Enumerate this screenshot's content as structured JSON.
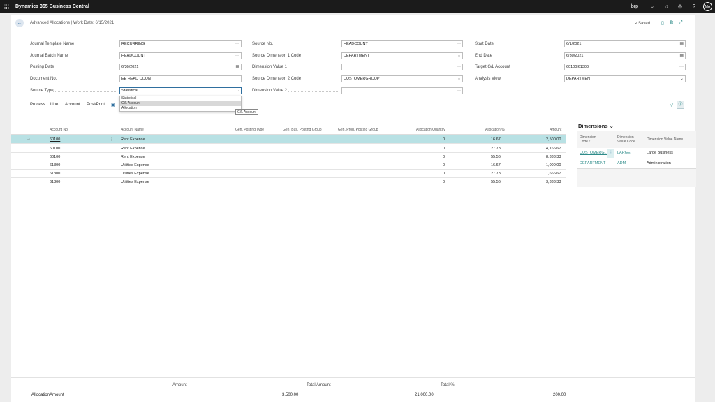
{
  "app": {
    "title": "Dynamics 365 Business Central",
    "company": "brp",
    "user_initials": "MA",
    "icons": [
      "waffle-icon",
      "search-icon",
      "bell-icon",
      "gear-icon",
      "help-icon"
    ]
  },
  "page": {
    "title": "Advanced Allocations | Work Date: 6/15/2021",
    "saved": "✓Saved"
  },
  "fields": {
    "journal_template_name": {
      "label": "Journal Template Name",
      "value": "RECURRING"
    },
    "journal_batch_name": {
      "label": "Journal Batch Name",
      "value": "HEADCOUNT"
    },
    "posting_date": {
      "label": "Posting Date",
      "value": "6/30/2021"
    },
    "document_no": {
      "label": "Document No.",
      "value": "EE HEAD COUNT"
    },
    "source_type": {
      "label": "Source Type",
      "value": "Statistical"
    },
    "source_no": {
      "label": "Source No.",
      "value": "HEADCOUNT"
    },
    "source_dim1_code": {
      "label": "Source Dimension 1 Code",
      "value": "DEPARTMENT"
    },
    "dimension_value_1": {
      "label": "Dimension Value 1",
      "value": ""
    },
    "source_dim2_code": {
      "label": "Source Dimension 2 Code",
      "value": "CUSTOMERGROUP"
    },
    "dimension_value_2": {
      "label": "Dimension Value 2",
      "value": ""
    },
    "start_date": {
      "label": "Start Date",
      "value": "6/1/2021"
    },
    "end_date": {
      "label": "End Date",
      "value": "6/30/2021"
    },
    "target_gl_account": {
      "label": "Target G/L Account",
      "value": "60100|61300"
    },
    "analysis_view": {
      "label": "Analysis View",
      "value": "DEPARTMENT"
    }
  },
  "dropdown": {
    "options": [
      "Statistical",
      "G/L Account",
      "Allocation"
    ],
    "highlighted": "G/L Account",
    "tooltip": "G/L Account"
  },
  "actions": [
    "Process",
    "Line",
    "Account",
    "Post/Print"
  ],
  "grid": {
    "columns": [
      "Account No.",
      "Account Name",
      "Gen. Posting Type",
      "Gen. Bus. Posting Group",
      "Gen. Prod. Posting Group",
      "Allocation Quantity",
      "Allocation %",
      "Amount"
    ],
    "rows": [
      {
        "account_no": "60100",
        "account_name": "Rent Expense",
        "qty": "0",
        "pct": "16.67",
        "amount": "2,500.00"
      },
      {
        "account_no": "60100",
        "account_name": "Rent Expense",
        "qty": "0",
        "pct": "27.78",
        "amount": "4,166.67"
      },
      {
        "account_no": "60100",
        "account_name": "Rent Expense",
        "qty": "0",
        "pct": "55.56",
        "amount": "8,333.33"
      },
      {
        "account_no": "61300",
        "account_name": "Utilities Expense",
        "qty": "0",
        "pct": "16.67",
        "amount": "1,000.00"
      },
      {
        "account_no": "61300",
        "account_name": "Utilities Expense",
        "qty": "0",
        "pct": "27.78",
        "amount": "1,666.67"
      },
      {
        "account_no": "61300",
        "account_name": "Utilities Expense",
        "qty": "0",
        "pct": "55.56",
        "amount": "3,333.33"
      }
    ]
  },
  "factbox": {
    "title": "Dimensions",
    "headers": {
      "code_l1": "Dimension",
      "code_l2": "Code ↑",
      "value_code_l1": "Dimension",
      "value_code_l2": "Value Code",
      "value_name": "Dimension Value Name"
    },
    "rows": [
      {
        "code": "CUSTOMERG...",
        "value_code": "LARGE",
        "value_name": "Large Business"
      },
      {
        "code": "DEPARTMENT",
        "value_code": "ADM",
        "value_name": "Administration"
      }
    ]
  },
  "totals": {
    "row_label": "AllocationAmount",
    "headers": [
      "Amount",
      "Total Amount",
      "Total %"
    ],
    "values": [
      "3,500.00",
      "21,000.00",
      "200.00"
    ]
  }
}
